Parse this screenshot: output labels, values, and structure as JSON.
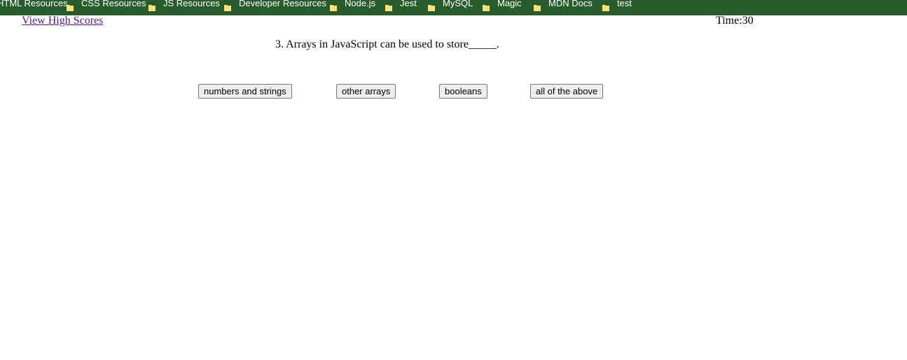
{
  "bookmarks": [
    {
      "label": "HTML Resources",
      "icon": "folder-icon"
    },
    {
      "label": "CSS Resources",
      "icon": "folder-icon"
    },
    {
      "label": "JS Resources",
      "icon": "folder-icon"
    },
    {
      "label": "Developer Resources",
      "icon": "folder-icon"
    },
    {
      "label": "Node.js",
      "icon": "folder-icon"
    },
    {
      "label": "Jest",
      "icon": "folder-icon"
    },
    {
      "label": "MySQL",
      "icon": "folder-icon"
    },
    {
      "label": "Magic",
      "icon": "folder-icon"
    },
    {
      "label": "MDN Docs",
      "icon": "folder-icon"
    },
    {
      "label": "test",
      "icon": "folder-icon"
    }
  ],
  "header": {
    "high_scores_label": "View High Scores",
    "timer_text": "Time:30"
  },
  "quiz": {
    "question": "3. Arrays in JavaScript can be used to store_____.",
    "answers": [
      "numbers and strings",
      "other arrays",
      "booleans",
      "all of the above"
    ]
  },
  "colors": {
    "bookmarks_bar": "#295c2d",
    "folder": "#f9e27a",
    "visited_link": "#551a8b"
  }
}
